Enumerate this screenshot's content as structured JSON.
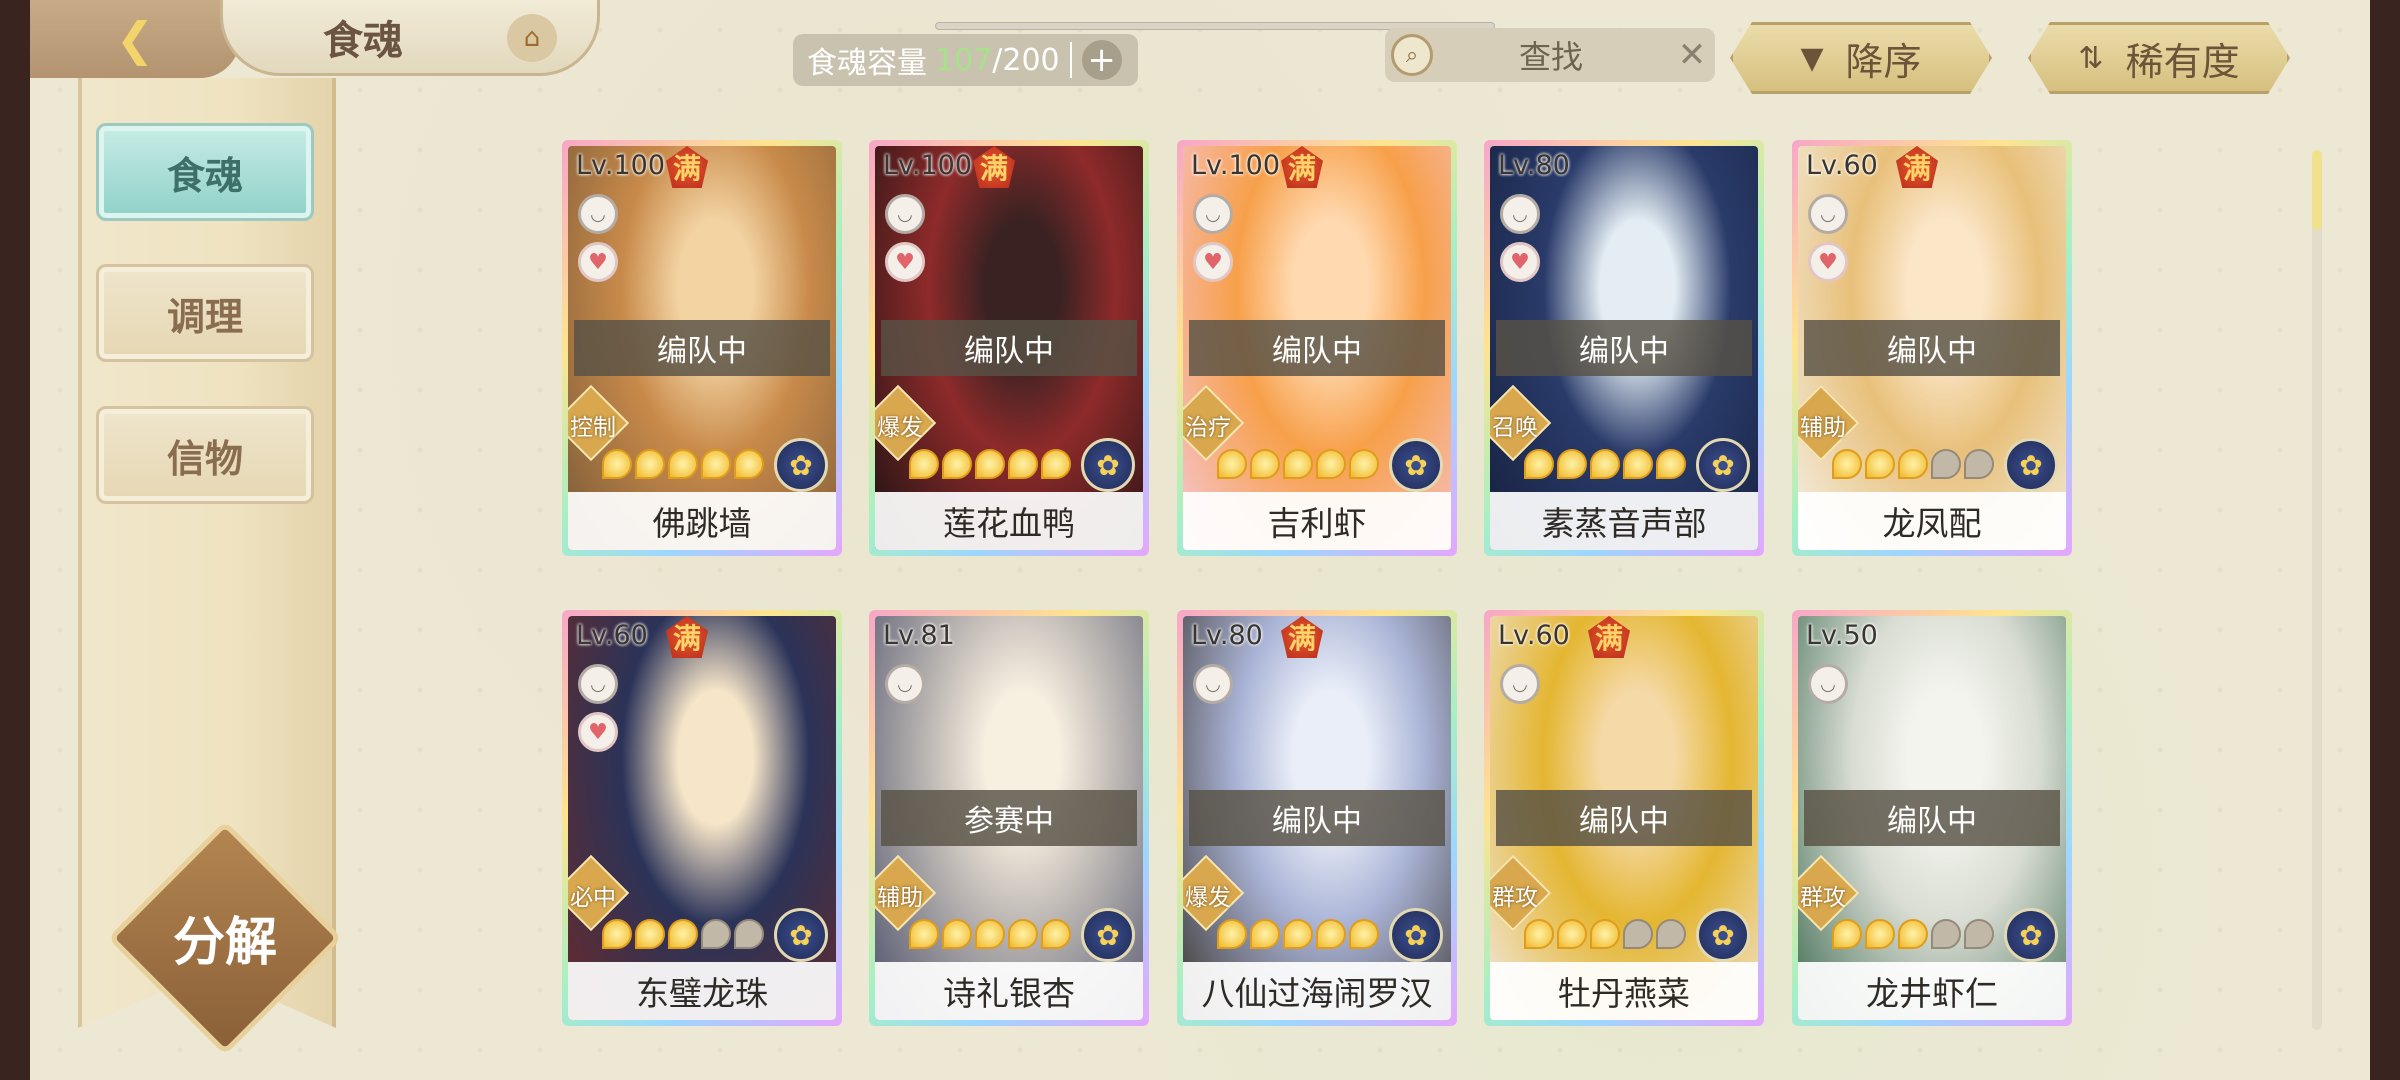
{
  "header": {
    "back_icon": "back-arrow-icon",
    "title": "食魂",
    "home_icon": "pavilion-icon",
    "capacity_label": "食魂容量",
    "capacity_current": "107",
    "capacity_max": "/200",
    "capacity_plus": "+",
    "search_label": "查找",
    "search_clear": "✕",
    "sort_order_label": "降序",
    "sort_key_label": "稀有度"
  },
  "sidebar": {
    "items": [
      {
        "label": "食魂",
        "active": true
      },
      {
        "label": "调理",
        "active": false
      },
      {
        "label": "信物",
        "active": false
      }
    ],
    "decompose_label": "分解"
  },
  "cards": [
    {
      "level": "Lv.100",
      "full": "满",
      "heart": true,
      "status": "编队中",
      "role": "控制",
      "stars": 5,
      "name": "佛跳墙",
      "art": [
        "#f3d3a2",
        "#c88a4a",
        "#7a5a38"
      ]
    },
    {
      "level": "Lv.100",
      "full": "满",
      "heart": true,
      "status": "编队中",
      "role": "爆发",
      "stars": 5,
      "name": "莲花血鸭",
      "art": [
        "#3a2222",
        "#8e2a2a",
        "#1a1212"
      ]
    },
    {
      "level": "Lv.100",
      "full": "满",
      "heart": true,
      "status": "编队中",
      "role": "治疗",
      "stars": 5,
      "name": "吉利虾",
      "art": [
        "#ffd9b0",
        "#f7a04a",
        "#f6c6d6"
      ]
    },
    {
      "level": "Lv.80",
      "full": "",
      "heart": true,
      "status": "编队中",
      "role": "召唤",
      "stars": 5,
      "name": "素蒸音声部",
      "art": [
        "#e3edf3",
        "#2a3b6a",
        "#15203d"
      ]
    },
    {
      "level": "Lv.60",
      "full": "满",
      "heart": true,
      "status": "编队中",
      "role": "辅助",
      "stars": 3,
      "name": "龙凤配",
      "art": [
        "#fbe6c8",
        "#e8c07a",
        "#f4f0e8"
      ]
    },
    {
      "level": "Lv.60",
      "full": "满",
      "heart": true,
      "status": "",
      "role": "必中",
      "stars": 3,
      "name": "东璧龙珠",
      "art": [
        "#f6e5c8",
        "#2b3358",
        "#6a2a2a"
      ]
    },
    {
      "level": "Lv.81",
      "full": "",
      "heart": false,
      "status": "参赛中",
      "role": "辅助",
      "stars": 5,
      "name": "诗礼银杏",
      "art": [
        "#f7efe0",
        "#bdb8b4",
        "#4b4f6a"
      ]
    },
    {
      "level": "Lv.80",
      "full": "满",
      "heart": false,
      "status": "编队中",
      "role": "爆发",
      "stars": 5,
      "name": "八仙过海闹罗汉",
      "art": [
        "#e9eef8",
        "#aab4d6",
        "#3a3530"
      ]
    },
    {
      "level": "Lv.60",
      "full": "满",
      "heart": false,
      "status": "编队中",
      "role": "群攻",
      "stars": 3,
      "name": "牡丹燕菜",
      "art": [
        "#f5d9a6",
        "#e4b631",
        "#f1e8e4"
      ]
    },
    {
      "level": "Lv.50",
      "full": "",
      "heart": false,
      "status": "编队中",
      "role": "群攻",
      "stars": 3,
      "name": "龙井虾仁",
      "art": [
        "#f3f4ee",
        "#d8dcd2",
        "#3e6b52"
      ]
    }
  ]
}
